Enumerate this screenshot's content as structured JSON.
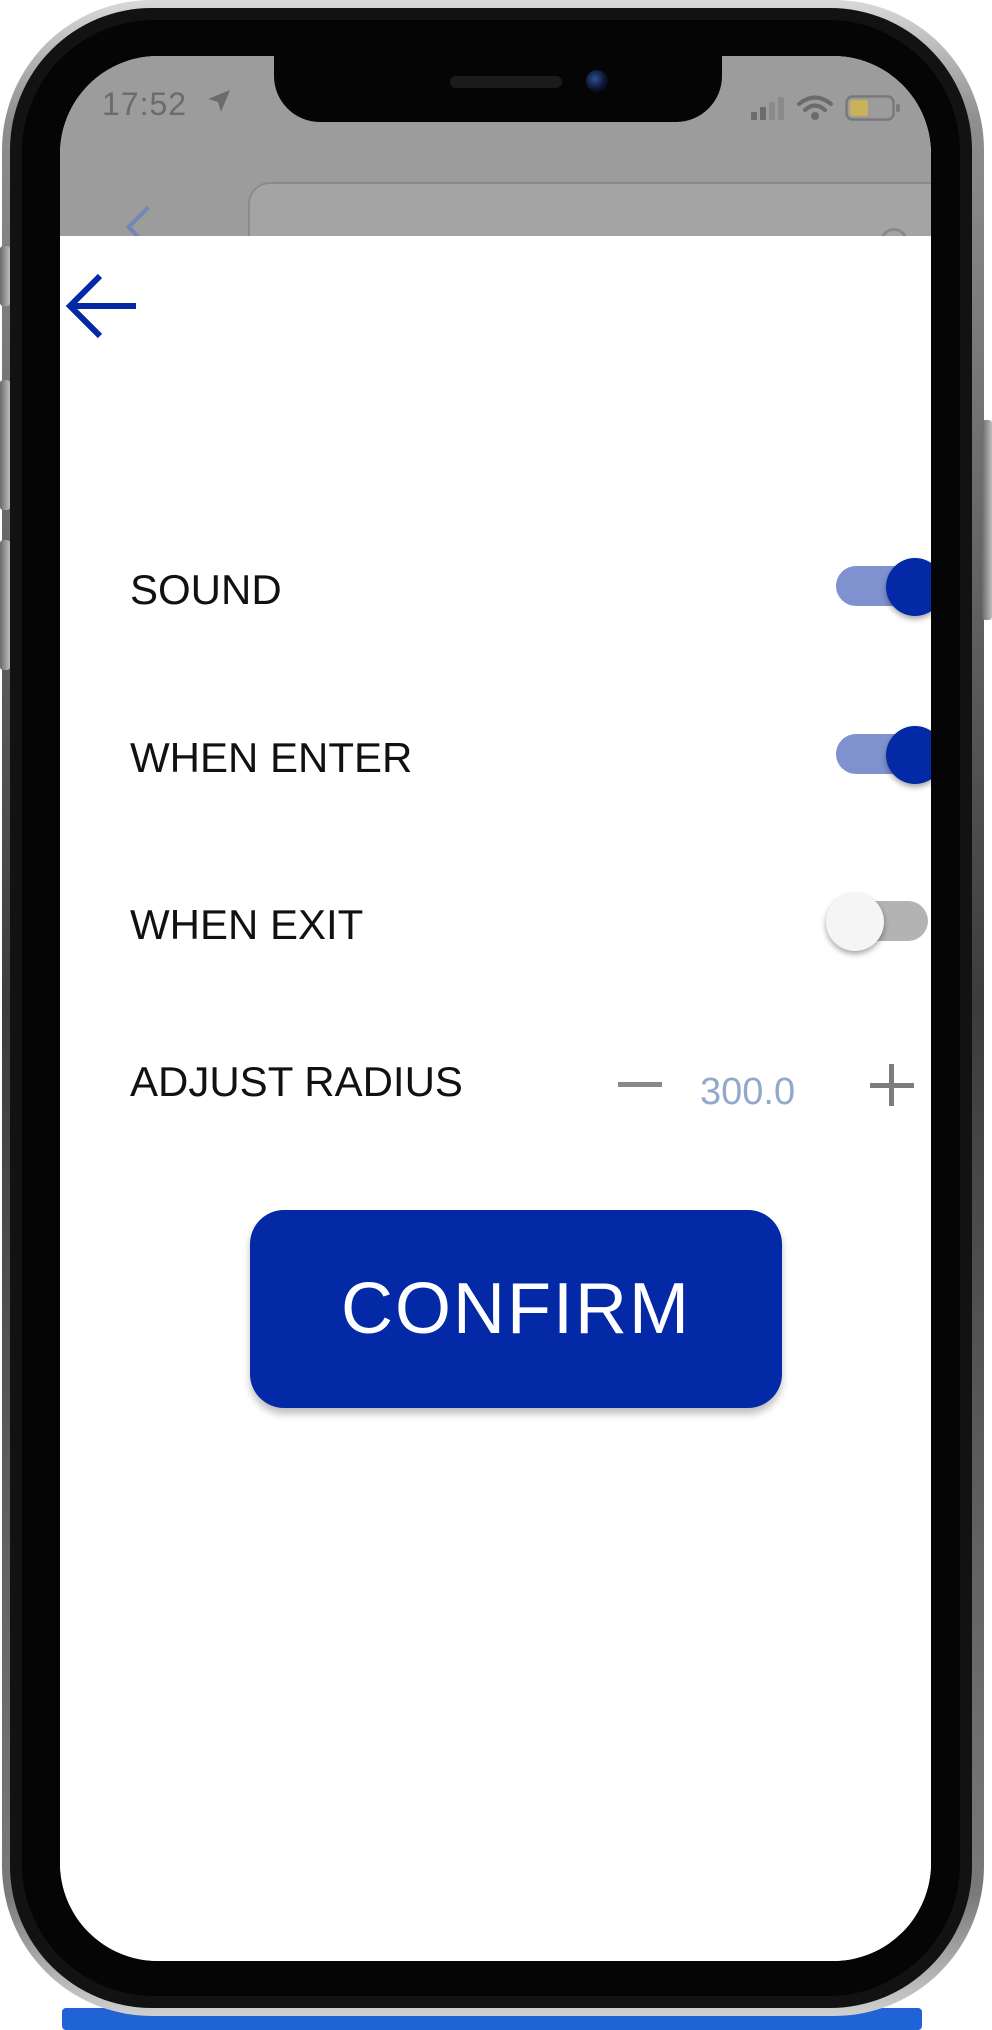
{
  "status_bar": {
    "time": "17:52"
  },
  "settings": {
    "items": [
      {
        "label": "SOUND",
        "enabled": true
      },
      {
        "label": "WHEN ENTER",
        "enabled": true
      },
      {
        "label": "WHEN EXIT",
        "enabled": false
      }
    ],
    "radius": {
      "label": "ADJUST RADIUS",
      "value": "300.0"
    }
  },
  "confirm_label": "CONFIRM",
  "colors": {
    "primary": "#0329a6",
    "toggle_track_on": "#7f92cf",
    "toggle_track_off": "#b3b3b3",
    "value_text": "#93a9c9"
  },
  "icons": {
    "back": "arrow-left-icon",
    "location": "location-arrow-icon",
    "signal": "signal-icon",
    "wifi": "wifi-icon",
    "battery": "battery-icon",
    "minus": "minus-icon",
    "plus": "plus-icon"
  }
}
